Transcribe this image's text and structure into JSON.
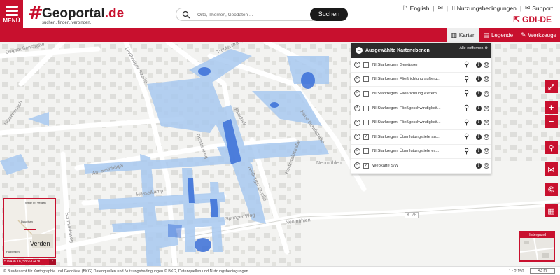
{
  "header": {
    "menu_label": "MENÜ",
    "logo_mark": "#",
    "logo_name": "Geoportal",
    "logo_tld": ".de",
    "logo_slogan": "suchen. finden. verbinden.",
    "search_placeholder": "Orte, Themen, Geodaten ...",
    "search_button": "Suchen",
    "links": [
      "English",
      "Nutzungsbedingungen",
      "Support"
    ],
    "gdi_label": "GDI-DE"
  },
  "tabs": [
    {
      "label": "Karten",
      "active": true
    },
    {
      "label": "Legende",
      "active": false
    },
    {
      "label": "Werkzeuge",
      "active": false
    }
  ],
  "panel": {
    "title": "Ausgewählte Kartenebenen",
    "remove_all": "Alle entfernen",
    "layers": [
      {
        "name": "NI Starkregen: Gewässer",
        "checked": false,
        "zoom": true
      },
      {
        "name": "NI Starkregen: Fließrichtung außerg...",
        "checked": false,
        "zoom": true
      },
      {
        "name": "NI Starkregen: Fließrichtung extrem...",
        "checked": false,
        "zoom": true
      },
      {
        "name": "NI Starkregen: Fließgeschwindigkeit...",
        "checked": false,
        "zoom": true
      },
      {
        "name": "NI Starkregen: Fließgeschwindigkeit...",
        "checked": false,
        "zoom": true
      },
      {
        "name": "NI Starkregen: Überflutungstiefe au...",
        "checked": true,
        "zoom": true
      },
      {
        "name": "NI Starkregen: Überflutungstiefe ex...",
        "checked": false,
        "zoom": true
      },
      {
        "name": "Webkarte S/W",
        "checked": true,
        "zoom": false
      }
    ]
  },
  "map": {
    "street_labels": [
      "Ostpreußenstraße",
      "Lindhooper Straße",
      "Trenterstraße",
      "Hülsenbusch",
      "Paddock",
      "Am Steinbügel",
      "Drostenweg",
      "Hasselkamp",
      "Nieburger Straße",
      "Neumühlen",
      "Neumühlen",
      "K 28",
      "Springer Weg",
      "Schmiedeweg",
      "Neue Schulstraße",
      "Hertzwaldstraße"
    ],
    "overview_labels": [
      "Walle (b) Verden",
      "Dauelsen",
      "Verden",
      "Hutbergen"
    ],
    "background_label": "Hintergrund",
    "coordinate": "516438.18, 5866374.90"
  },
  "footer": {
    "attribution": "© Bundesamt für Kartographie und Geodäsie (BKG) Datenquellen und Nutzungsbedingungen  © BKG, Datenquellen und Nutzungsbedingungen",
    "scale": "1 : 2 150",
    "scalebar": "43 m"
  },
  "colors": {
    "brand_red": "#c8102e",
    "flood_light": "#a9c9f0",
    "flood_dark": "#3a6fd8"
  },
  "icons": [
    "search-icon",
    "flag-icon",
    "share-icon",
    "document-icon",
    "mail-icon",
    "external-link-icon",
    "map-icon",
    "legend-icon",
    "tools-icon",
    "fullscreen-icon",
    "zoom-in-icon",
    "zoom-out-icon",
    "location-icon",
    "share-icon",
    "copyright-icon",
    "bookmark-map-icon"
  ]
}
